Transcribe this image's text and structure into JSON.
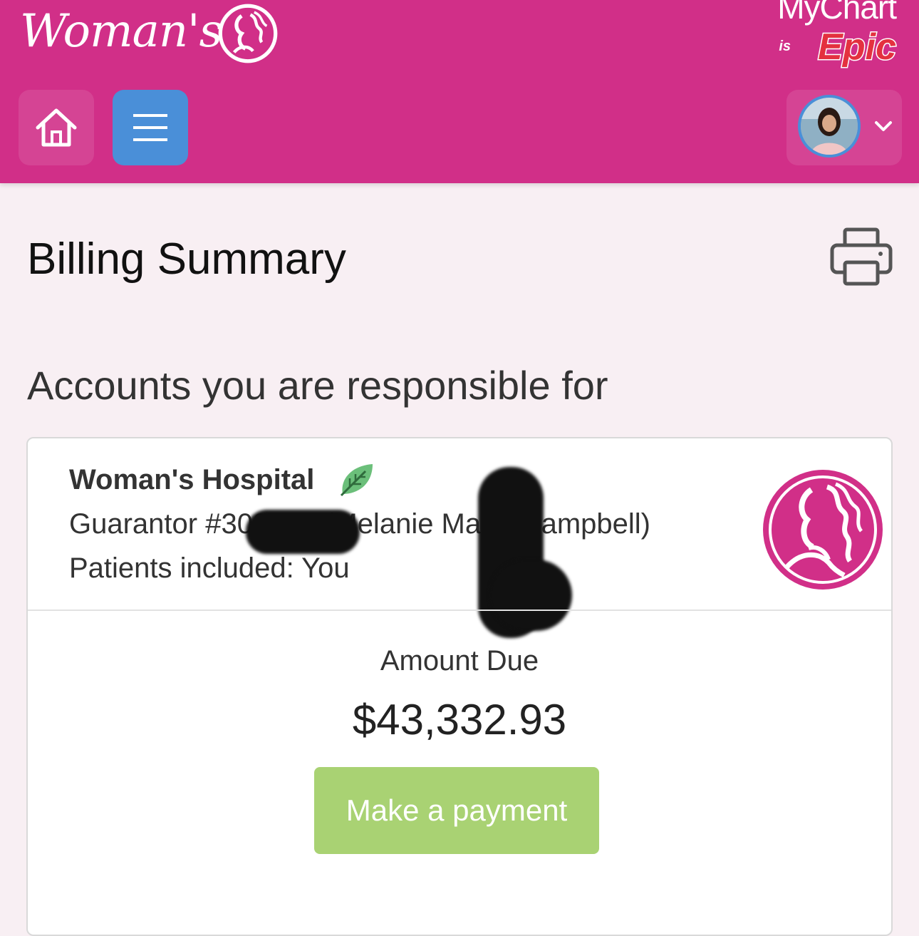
{
  "header": {
    "brand_name": "Woman's",
    "mychart_label": "MyChart",
    "is_label": "is",
    "epic_label": "Epic",
    "home_icon": "home-icon",
    "menu_icon": "hamburger-menu-icon",
    "profile_icon": "chevron-down-icon",
    "brand_color": "#d12f88",
    "menu_color": "#4a8fd8"
  },
  "main": {
    "title": "Billing Summary",
    "print_icon": "printer-icon",
    "section_title": "Accounts you are responsible for"
  },
  "account": {
    "hospital_name": "Woman's Hospital",
    "guarantor": "Guarantor #309035 (Melanie Marie Campbell)",
    "patients": "Patients included: You",
    "amount_label": "Amount Due",
    "amount_value": "$43,332.93",
    "pay_button": "Make a payment",
    "pay_color": "#a9d273"
  }
}
